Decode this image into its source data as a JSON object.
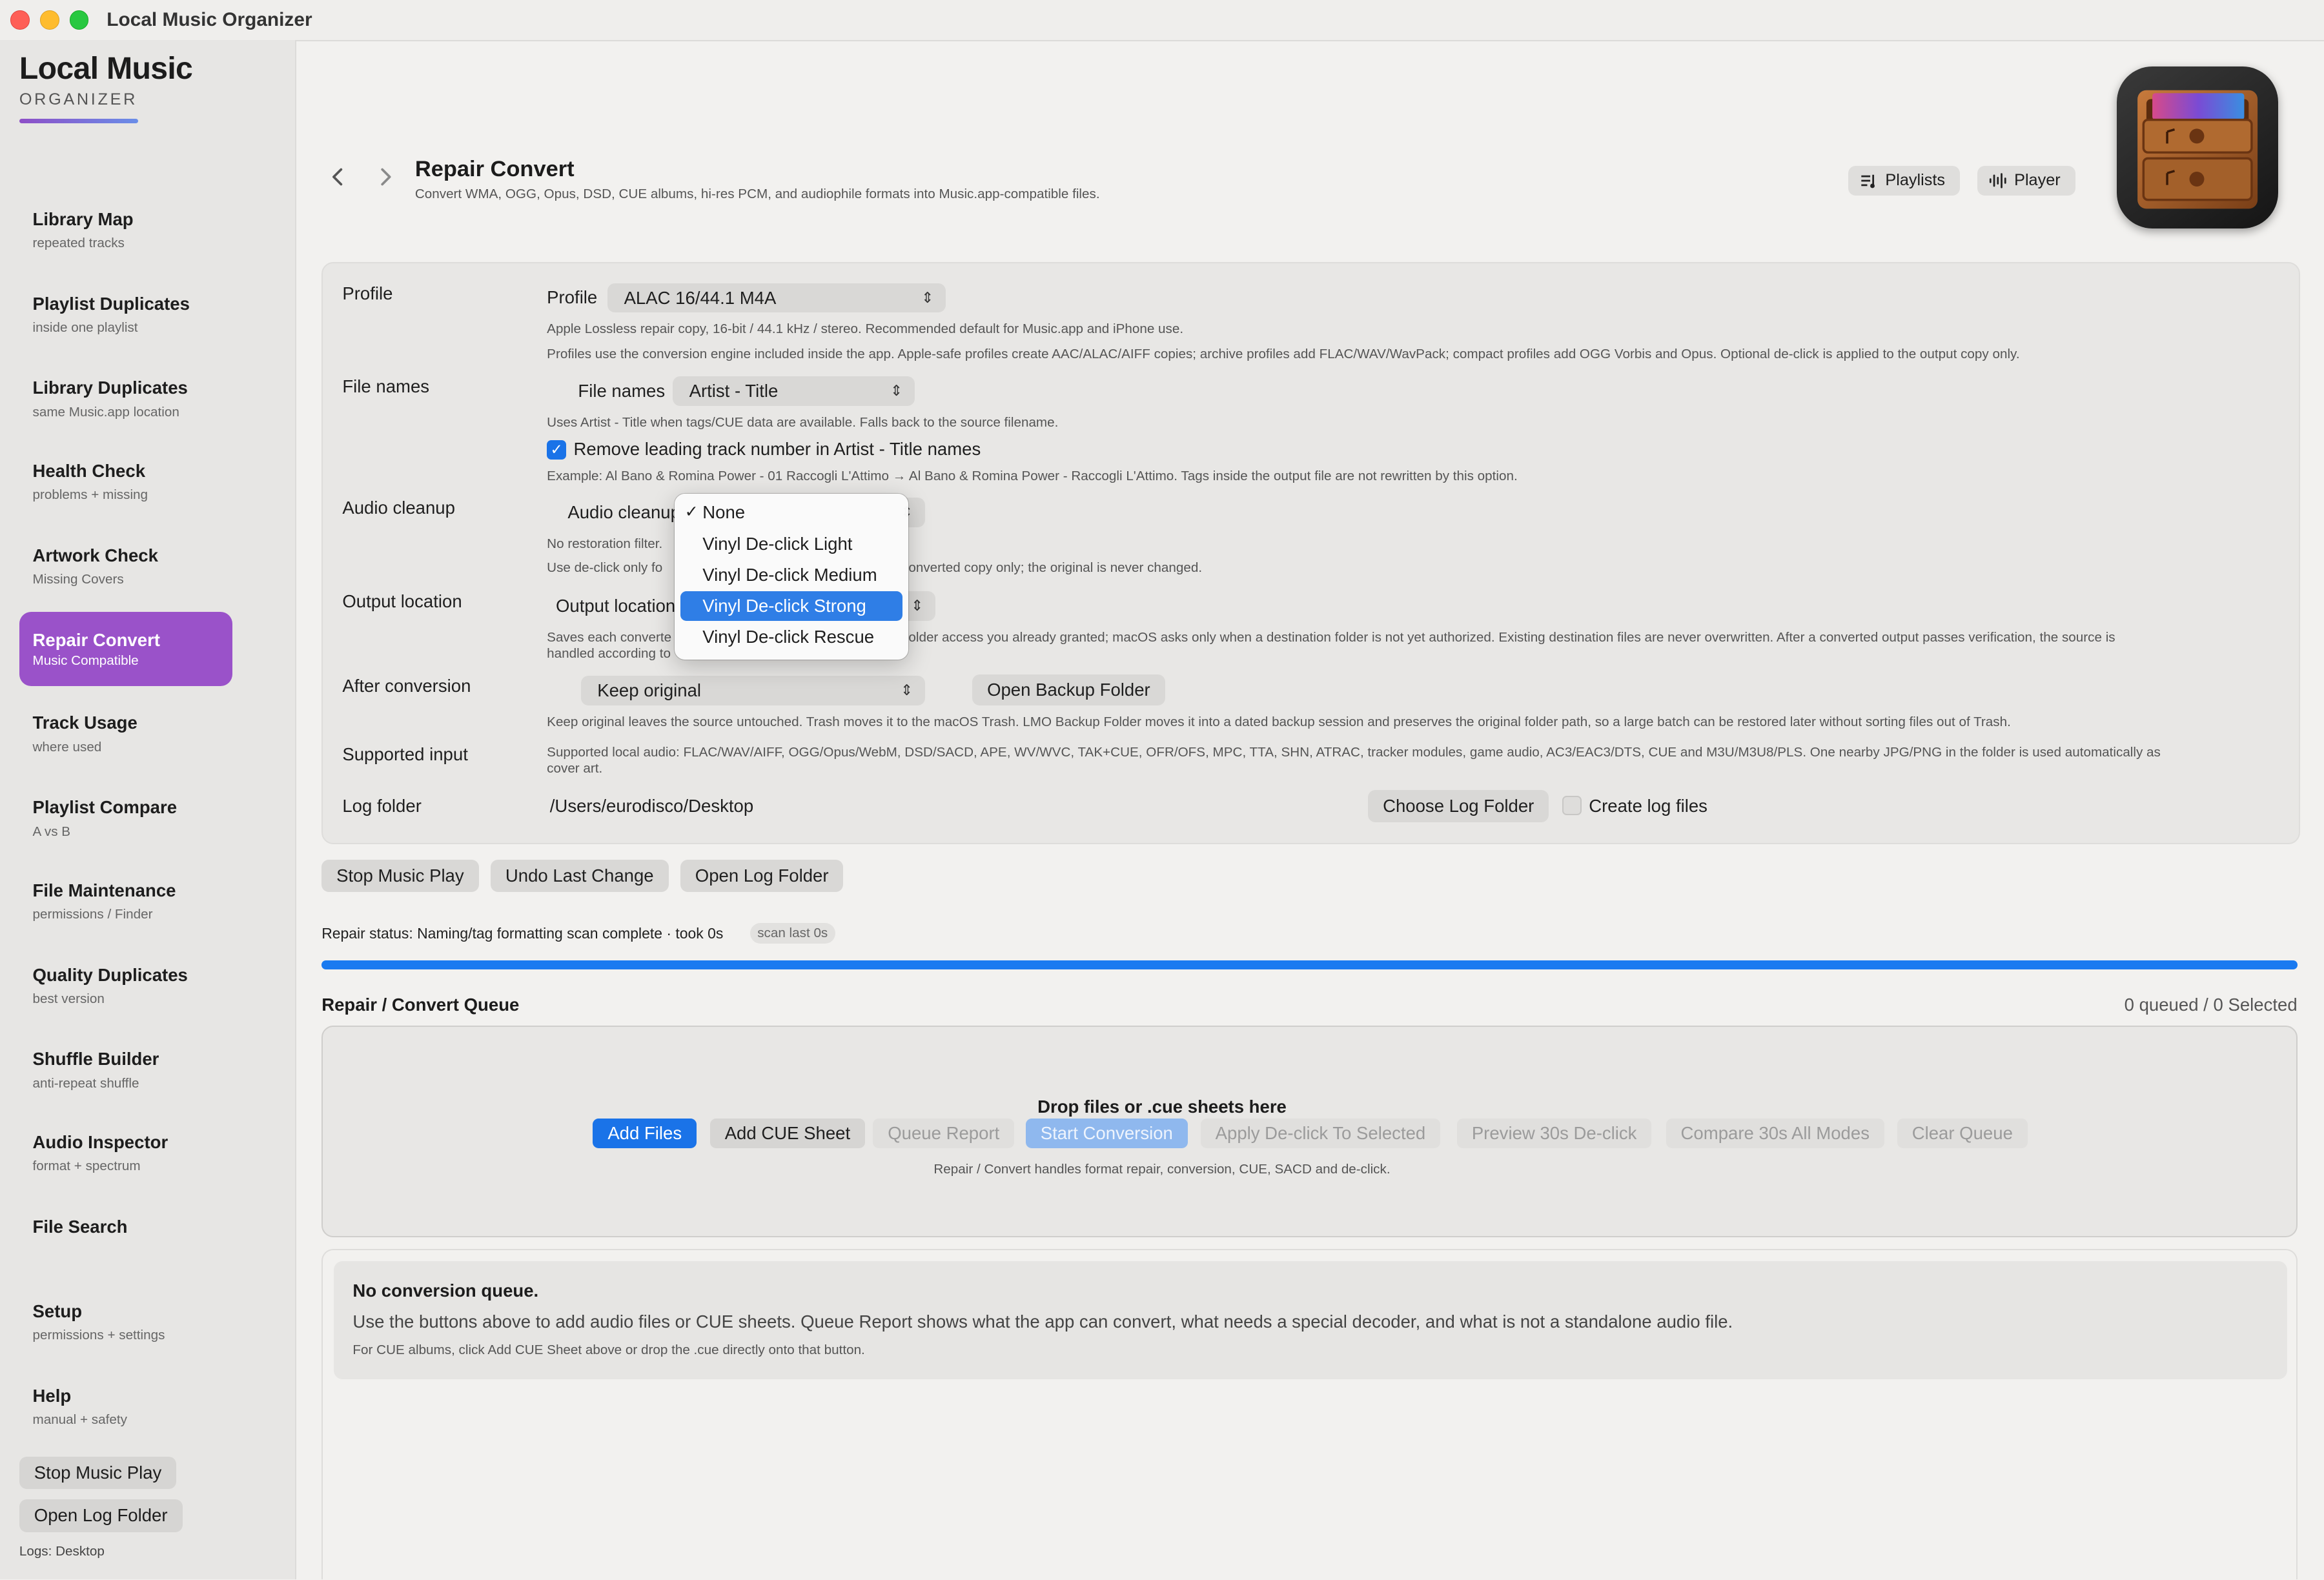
{
  "window": {
    "title": "Local Music Organizer"
  },
  "brand": {
    "name": "Local Music",
    "sub": "ORGANIZER"
  },
  "sidebar": {
    "items": [
      {
        "label": "Library Map",
        "sub": "repeated tracks"
      },
      {
        "label": "Playlist Duplicates",
        "sub": "inside one playlist"
      },
      {
        "label": "Library Duplicates",
        "sub": "same Music.app location"
      },
      {
        "label": "Health Check",
        "sub": "problems + missing"
      },
      {
        "label": "Artwork Check",
        "sub": "Missing Covers"
      },
      {
        "label": "Repair Convert",
        "sub": "Music Compatible"
      },
      {
        "label": "Track Usage",
        "sub": "where used"
      },
      {
        "label": "Playlist Compare",
        "sub": "A vs B"
      },
      {
        "label": "File Maintenance",
        "sub": "permissions / Finder"
      },
      {
        "label": "Quality Duplicates",
        "sub": "best version"
      },
      {
        "label": "Shuffle Builder",
        "sub": "anti-repeat shuffle"
      },
      {
        "label": "Audio Inspector",
        "sub": "format + spectrum"
      },
      {
        "label": "File Search",
        "sub": ""
      },
      {
        "label": "Setup",
        "sub": "permissions + settings"
      },
      {
        "label": "Help",
        "sub": "manual + safety"
      }
    ],
    "stop_music": "Stop Music Play",
    "open_log": "Open Log Folder",
    "logs_label": "Logs: Desktop"
  },
  "header": {
    "title": "Repair Convert",
    "subtitle": "Convert WMA, OGG, Opus, DSD, CUE albums, hi-res PCM, and audiophile formats into Music.app-compatible files.",
    "playlists": "Playlists",
    "player": "Player",
    "back_icon": "chevron-left-icon",
    "forward_icon": "chevron-right-icon"
  },
  "settings": {
    "profile": {
      "row_label": "Profile",
      "control_label": "Profile",
      "value": "ALAC 16/44.1 M4A",
      "note1": "Apple Lossless repair copy, 16-bit / 44.1 kHz / stereo. Recommended default for Music.app and iPhone use.",
      "note2": "Profiles use the conversion engine included inside the app. Apple-safe profiles create AAC/ALAC/AIFF copies; archive profiles add FLAC/WAV/WavPack; compact profiles add OGG Vorbis and Opus. Optional de-click is applied to the output copy only."
    },
    "file_names": {
      "row_label": "File names",
      "control_label": "File names",
      "value": "Artist - Title",
      "note": "Uses Artist - Title when tags/CUE data are available. Falls back to the source filename.",
      "checkbox_label": "Remove leading track number in Artist - Title names",
      "example": "Example: Al Bano & Romina Power - 01 Raccogli L'Attimo → Al Bano & Romina Power - Raccogli L'Attimo. Tags inside the output file are not rewritten by this option."
    },
    "audio_cleanup": {
      "row_label": "Audio cleanup",
      "control_label": "Audio cleanup",
      "note1": "No restoration filter.",
      "note2_left": "Use de-click only fo",
      "note2_right": "onverted copy only; the original is never changed."
    },
    "output": {
      "row_label": "Output location",
      "control_label": "Output location",
      "note_left": "Saves each converte",
      "note_right": "older access you already granted; macOS asks only when a destination folder is not yet authorized. Existing destination files are never overwritten. After a converted output passes verification, the source is",
      "note_line2": "handled according to"
    },
    "after": {
      "row_label": "After conversion",
      "value": "Keep original",
      "backup_button": "Open Backup Folder",
      "note": "Keep original leaves the source untouched. Trash moves it to the macOS Trash. LMO Backup Folder moves it into a dated backup session and preserves the original folder path, so a large batch can be restored later without sorting files out of Trash."
    },
    "supported": {
      "row_label": "Supported input",
      "note": "Supported local audio: FLAC/WAV/AIFF, OGG/Opus/WebM, DSD/SACD, APE, WV/WVC, TAK+CUE, OFR/OFS, MPC, TTA, SHN, ATRAC, tracker modules, game audio, AC3/EAC3/DTS, CUE and M3U/M3U8/PLS. One nearby JPG/PNG in the folder is used automatically as cover art."
    },
    "log": {
      "row_label": "Log folder",
      "path": "/Users/eurodisco/Desktop",
      "choose_button": "Choose Log Folder",
      "create_label": "Create log files"
    }
  },
  "menu": {
    "items": [
      "None",
      "Vinyl De-click Light",
      "Vinyl De-click Medium",
      "Vinyl De-click Strong",
      "Vinyl De-click Rescue"
    ],
    "checked": "None",
    "highlighted": "Vinyl De-click Strong",
    "tick": "✓"
  },
  "actions": {
    "stop_music": "Stop Music Play",
    "undo": "Undo Last Change",
    "open_log": "Open Log Folder"
  },
  "status": {
    "text": "Repair status: Naming/tag formatting scan complete · took 0s",
    "pill": "scan last 0s",
    "progress": 1.0,
    "accent": "#1a7af0"
  },
  "queue": {
    "title": "Repair / Convert Queue",
    "count": "0 queued / 0 Selected",
    "drop_title": "Drop files or .cue sheets here",
    "buttons": {
      "add_files": "Add Files",
      "add_cue": "Add CUE Sheet",
      "queue_report": "Queue Report",
      "start": "Start Conversion",
      "apply_declick": "Apply De-click To Selected",
      "preview": "Preview 30s De-click",
      "compare": "Compare 30s All Modes",
      "clear": "Clear Queue"
    },
    "hint": "Repair / Convert handles format repair, conversion, CUE, SACD and de-click."
  },
  "empty": {
    "title": "No conversion queue.",
    "body": "Use the buttons above to add audio files or CUE sheets. Queue Report shows what the app can convert, what needs a special decoder, and what is not a standalone audio file.",
    "hint": "For CUE albums, click Add CUE Sheet above or drop the .cue directly onto that button."
  }
}
